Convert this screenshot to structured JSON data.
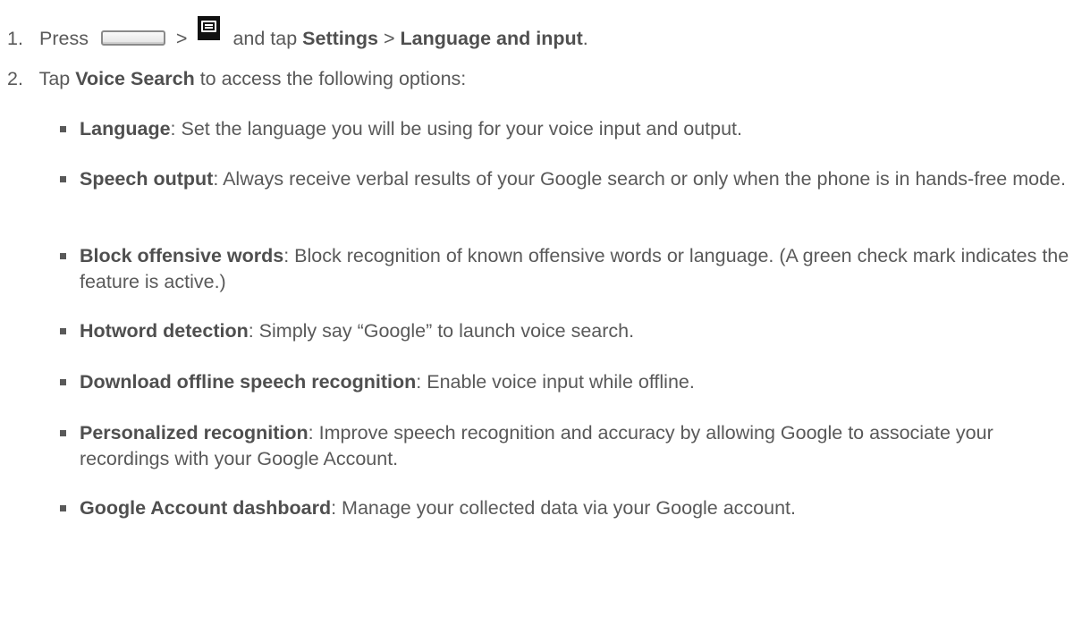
{
  "steps": [
    {
      "num": "1.",
      "press": "Press",
      "sep1": ">",
      "and_tap": "and tap",
      "settings": "Settings",
      "sep2": ">",
      "lang_input": "Language and input",
      "end": ".",
      "icons": [
        "home-key-icon",
        "menu-key-icon"
      ]
    },
    {
      "num": "2.",
      "tap": "Tap",
      "voice_search": "Voice Search",
      "rest": "to access the following options:"
    }
  ],
  "options": [
    {
      "term": "Language",
      "desc": ": Set the language you will be using for your voice input and output."
    },
    {
      "term": "Speech output",
      "desc": ": Always receive verbal results of your Google search or only when the phone is in hands-free mode."
    },
    {
      "term": "Block offensive words",
      "desc": ": Block recognition of known offensive words or language. (A green check mark indicates the feature is active.)"
    },
    {
      "term": "Hotword detection",
      "desc": ": Simply say “Google” to launch voice search."
    },
    {
      "term": "Download offline speech recognition",
      "desc": ": Enable voice input while offline."
    },
    {
      "term": "Personalized recognition",
      "desc": ": Improve speech recognition and accuracy by allowing Google to associate your recordings with your Google Account."
    },
    {
      "term": "Google Account dashboard",
      "desc": ": Manage your collected data via your Google account."
    }
  ]
}
